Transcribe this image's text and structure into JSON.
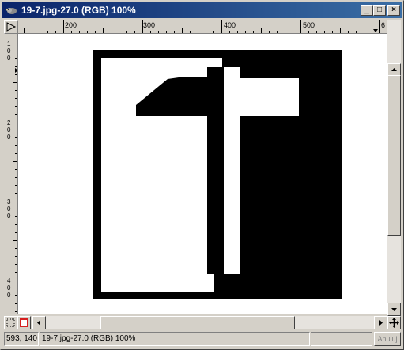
{
  "window": {
    "title": "19-7.jpg-27.0 (RGB) 100%",
    "minimize_glyph": "_",
    "maximize_glyph": "□",
    "close_glyph": "×"
  },
  "rulers": {
    "horizontal_labels": [
      "200",
      "300",
      "400",
      "500",
      "6"
    ],
    "vertical_labels": [
      [
        "1",
        "0",
        "0"
      ],
      [
        "2",
        "0",
        "0"
      ],
      [
        "3",
        "0",
        "0"
      ],
      [
        "4",
        "0",
        "0"
      ]
    ]
  },
  "statusbar": {
    "coordinates": "593, 140",
    "image_info": "19-7.jpg-27.0 (RGB) 100%",
    "cancel_label": "Anuluj"
  },
  "icons": {
    "ruler_corner": "triangle-arrow-icon",
    "quickmask": "quickmask-icon",
    "navigate": "navigate-crosshair-icon"
  },
  "colors": {
    "titlebar_start": "#0a246a",
    "titlebar_end": "#3a6ea5",
    "canvas_bg": "#ffffff",
    "image_ink": "#000000",
    "quickmask_red": "#d62020"
  }
}
